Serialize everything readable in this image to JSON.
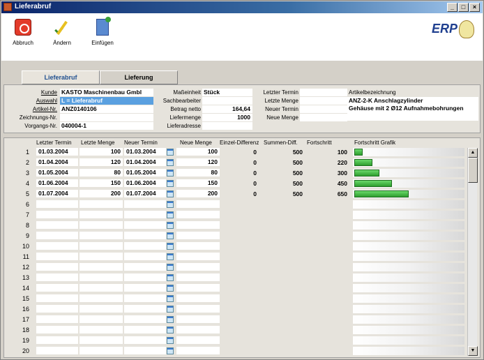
{
  "window": {
    "title": "Lieferabruf",
    "controls": [
      "_",
      "□",
      "×"
    ]
  },
  "toolbar": {
    "buttons": [
      {
        "label": "Abbruch",
        "icon": "abort-icon"
      },
      {
        "label": "Ändern",
        "icon": "edit-icon"
      },
      {
        "label": "Einfügen",
        "icon": "insert-icon"
      }
    ],
    "logo": "ERP"
  },
  "tabs": [
    {
      "label": "Lieferabruf",
      "active": true
    },
    {
      "label": "Lieferung",
      "active": false
    }
  ],
  "header": {
    "kunde": {
      "label": "Kunde",
      "value": "KASTO Maschinenbau Gmbl"
    },
    "auswahl": {
      "label": "Auswahl",
      "value": "L = Lieferabruf"
    },
    "artikel": {
      "label": "Artikel-Nr.",
      "value": "ANZ0140106"
    },
    "zeichnung": {
      "label": "Zeichnungs-Nr.",
      "value": ""
    },
    "vorgang": {
      "label": "Vorgangs-Nr.",
      "value": "040004-1"
    },
    "masseinheit": {
      "label": "Maßeinheit",
      "value": "Stück"
    },
    "sachbearbeiter": {
      "label": "Sachbearbeiter",
      "value": ""
    },
    "betrag": {
      "label": "Betrag netto",
      "value": "164,64"
    },
    "liefermenge": {
      "label": "Liefermenge",
      "value": "1000"
    },
    "lieferadresse": {
      "label": "Lieferadresse",
      "value": ""
    },
    "letzter_termin": {
      "label": "Letzter Termin",
      "value": ""
    },
    "letzte_menge": {
      "label": "Letzte Menge",
      "value": ""
    },
    "neuer_termin": {
      "label": "Neuer Termin",
      "value": ""
    },
    "neue_menge": {
      "label": "Neue Menge",
      "value": ""
    },
    "artikelbez": {
      "label": "Artikelbezeichnung",
      "line1": "ANZ-2-K Anschlagzylinder",
      "line2": "Gehäuse mit 2 Ø12 Aufnahmebohrungen"
    }
  },
  "grid": {
    "columns": [
      "Letzter Termin",
      "Letzte Menge",
      "Neuer Termin",
      "Neue Menge",
      "Einzel-Differenz",
      "Summen-Diff.",
      "Fortschritt",
      "Fortschritt Grafik"
    ],
    "rows": [
      {
        "n": "1",
        "lt": "01.03.2004",
        "lm": "100",
        "nt": "01.03.2004",
        "nm": "100",
        "ed": "0",
        "sd": "500",
        "fs": "100",
        "progress": 100
      },
      {
        "n": "2",
        "lt": "01.04.2004",
        "lm": "120",
        "nt": "01.04.2004",
        "nm": "120",
        "ed": "0",
        "sd": "500",
        "fs": "220",
        "progress": 220
      },
      {
        "n": "3",
        "lt": "01.05.2004",
        "lm": "80",
        "nt": "01.05.2004",
        "nm": "80",
        "ed": "0",
        "sd": "500",
        "fs": "300",
        "progress": 300
      },
      {
        "n": "4",
        "lt": "01.06.2004",
        "lm": "150",
        "nt": "01.06.2004",
        "nm": "150",
        "ed": "0",
        "sd": "500",
        "fs": "450",
        "progress": 450
      },
      {
        "n": "5",
        "lt": "01.07.2004",
        "lm": "200",
        "nt": "01.07.2004",
        "nm": "200",
        "ed": "0",
        "sd": "500",
        "fs": "650",
        "progress": 650
      },
      {
        "n": "6"
      },
      {
        "n": "7"
      },
      {
        "n": "8"
      },
      {
        "n": "9"
      },
      {
        "n": "10"
      },
      {
        "n": "11"
      },
      {
        "n": "12"
      },
      {
        "n": "13"
      },
      {
        "n": "14"
      },
      {
        "n": "15"
      },
      {
        "n": "16"
      },
      {
        "n": "17"
      },
      {
        "n": "18"
      },
      {
        "n": "19"
      },
      {
        "n": "20"
      }
    ]
  }
}
